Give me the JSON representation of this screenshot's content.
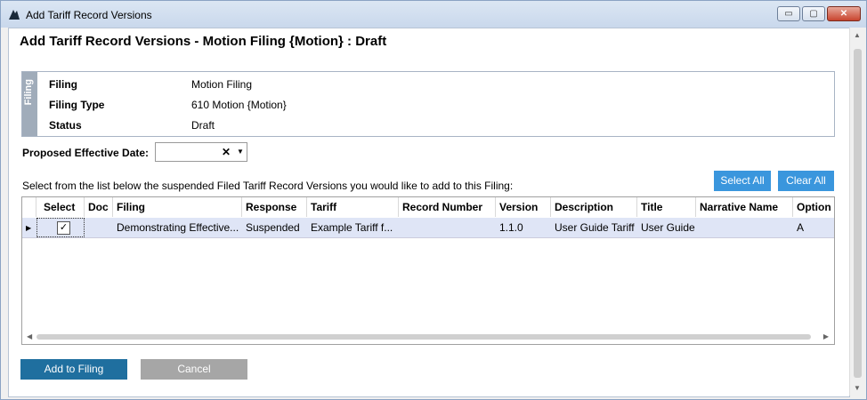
{
  "window": {
    "title": "Add Tariff Record Versions",
    "controls": {
      "minimize": "▭",
      "maximize": "▢",
      "close": "✕"
    }
  },
  "heading": "Add Tariff Record Versions - Motion Filing {Motion} : Draft",
  "info": {
    "tab_label": "Filing",
    "rows": [
      {
        "label": "Filing",
        "value": "Motion Filing"
      },
      {
        "label": "Filing Type",
        "value": "610 Motion {Motion}"
      },
      {
        "label": "Status",
        "value": "Draft"
      }
    ]
  },
  "proposed_date": {
    "label": "Proposed Effective Date:",
    "value": "",
    "clear": "✕",
    "dropdown": "▼"
  },
  "buttons": {
    "select_all": "Select All",
    "clear_all": "Clear All",
    "add": "Add to Filing",
    "cancel": "Cancel"
  },
  "instructions": "Select from the list below the suspended Filed Tariff Record Versions you would like to add to this Filing:",
  "grid": {
    "columns": [
      "Select",
      "Doc",
      "Filing",
      "Response",
      "Tariff",
      "Record Number",
      "Version",
      "Description",
      "Title",
      "Narrative Name",
      "Option"
    ],
    "rows": [
      {
        "selected": true,
        "check": "✓",
        "doc": "",
        "filing": "Demonstrating Effective...",
        "response": "Suspended",
        "tariff": "Example Tariff f...",
        "record_number": "",
        "version": "1.1.0",
        "description": "User Guide Tariff",
        "title": "User Guide",
        "narrative_name": "",
        "option": "A"
      }
    ]
  },
  "colors": {
    "primary": "#3a96dd",
    "primary_dark": "#1f6f9f",
    "disabled": "#a6a6a6",
    "selected_row": "#dfe5f6"
  }
}
